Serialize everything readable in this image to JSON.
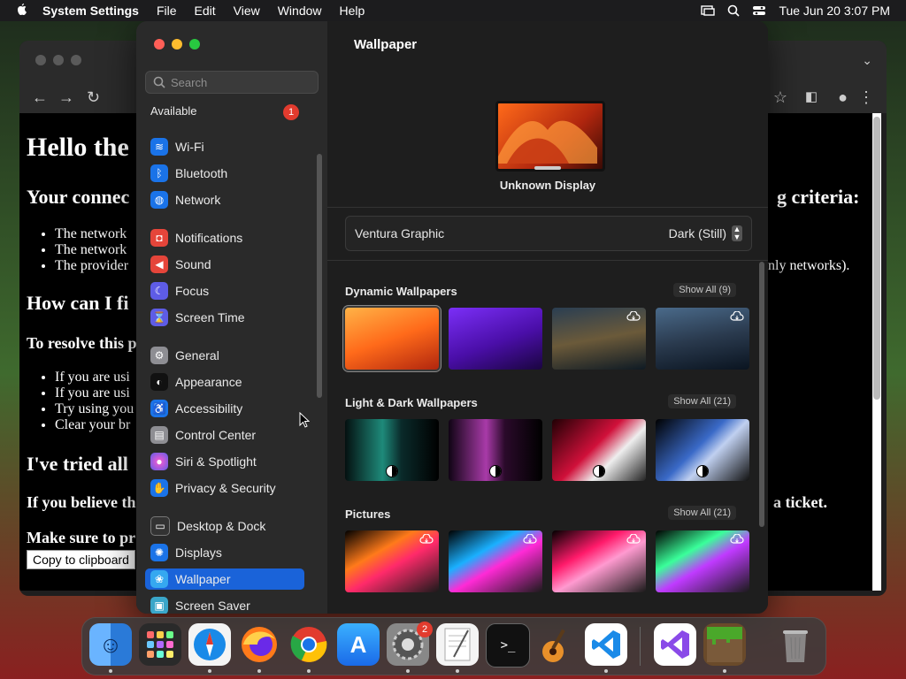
{
  "menubar": {
    "app": "System Settings",
    "items": [
      "File",
      "Edit",
      "View",
      "Window",
      "Help"
    ],
    "clock": "Tue Jun 20  3:07 PM"
  },
  "browser": {
    "h1": "Hello the",
    "h2a": "Your connec",
    "h2a_right": "g criteria:",
    "bullets1": [
      "The network",
      "The network",
      "The provider"
    ],
    "bullets1_right": "nly networks).",
    "h2b": "How can I fi",
    "h3a": "To resolve this p",
    "bullets2": [
      "If you are usi",
      "If you are usi",
      "Try using you",
      "Clear your br"
    ],
    "h2c": "I've tried all",
    "h3b": "If you believe th",
    "h3b_right": "a ticket.",
    "h3c": "Make sure to pr",
    "copy_button": "Copy to clipboard"
  },
  "settings": {
    "search_placeholder": "Search",
    "available_label": "Available",
    "available_badge": "1",
    "sidebar": [
      {
        "label": "Wi-Fi",
        "color": "#1a73e8",
        "glyph": "≋"
      },
      {
        "label": "Bluetooth",
        "color": "#1a73e8",
        "glyph": "ᛒ"
      },
      {
        "label": "Network",
        "color": "#1a73e8",
        "glyph": "◍"
      },
      {
        "label": "Notifications",
        "color": "#e5453a",
        "glyph": "◘"
      },
      {
        "label": "Sound",
        "color": "#e5453a",
        "glyph": "◀"
      },
      {
        "label": "Focus",
        "color": "#5e5ce6",
        "glyph": "☾"
      },
      {
        "label": "Screen Time",
        "color": "#5e5ce6",
        "glyph": "⌛"
      },
      {
        "label": "General",
        "color": "#8e8e93",
        "glyph": "⚙"
      },
      {
        "label": "Appearance",
        "color": "#111111",
        "glyph": "◐"
      },
      {
        "label": "Accessibility",
        "color": "#1a73e8",
        "glyph": "♿"
      },
      {
        "label": "Control Center",
        "color": "#8e8e93",
        "glyph": "▤"
      },
      {
        "label": "Siri & Spotlight",
        "color": "#b13ac9",
        "glyph": "●"
      },
      {
        "label": "Privacy & Security",
        "color": "#1a73e8",
        "glyph": "✋"
      },
      {
        "label": "Desktop & Dock",
        "color": "#333333",
        "glyph": "▭"
      },
      {
        "label": "Displays",
        "color": "#1a73e8",
        "glyph": "✺"
      },
      {
        "label": "Wallpaper",
        "color": "#35a8f0",
        "glyph": "❀"
      },
      {
        "label": "Screen Saver",
        "color": "#3aa6c9",
        "glyph": "▣"
      }
    ],
    "main": {
      "title": "Wallpaper",
      "display_label": "Unknown Display",
      "wallpaper_name": "Ventura Graphic",
      "wallpaper_mode": "Dark (Still)",
      "sections": [
        {
          "title": "Dynamic Wallpapers",
          "show_all": "Show All (9)"
        },
        {
          "title": "Light & Dark Wallpapers",
          "show_all": "Show All (21)"
        },
        {
          "title": "Pictures",
          "show_all": "Show All (21)"
        }
      ]
    }
  },
  "dock": {
    "apps": [
      "Finder",
      "Launchpad",
      "Safari",
      "Firefox",
      "Chrome",
      "App Store",
      "System Settings",
      "TextEdit",
      "Terminal",
      "GarageBand",
      "Visual Studio Code",
      "Visual Studio",
      "Minecraft",
      "Trash"
    ],
    "settings_badge": "2"
  }
}
